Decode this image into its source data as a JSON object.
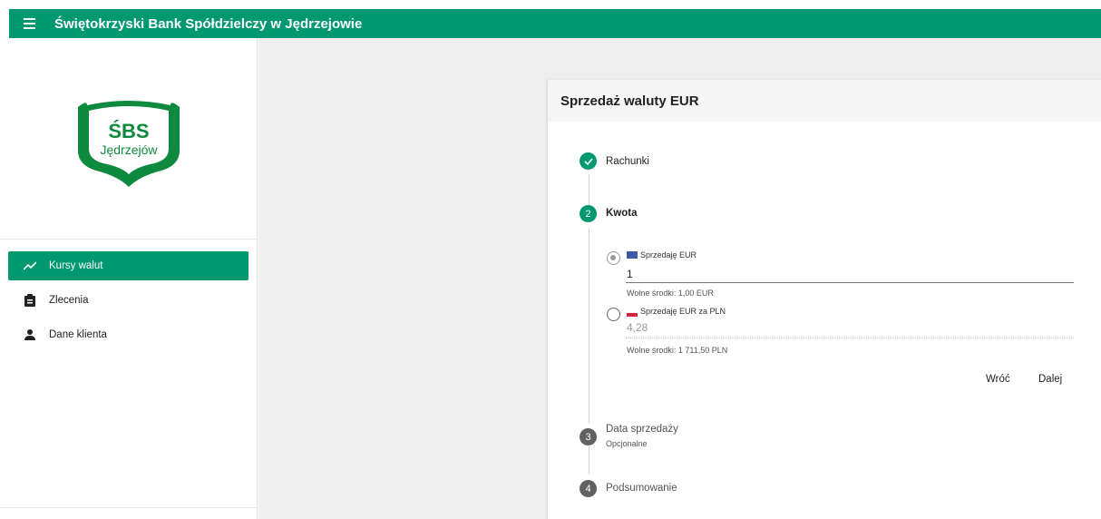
{
  "header": {
    "title": "Świętokrzyski Bank Spółdzielczy w Jędrzejowie"
  },
  "logo": {
    "line1": "ŚBS",
    "line2": "Jędrzejów"
  },
  "sidebar": {
    "items": [
      {
        "label": "Kursy walut",
        "icon": "trending-up-icon",
        "active": true
      },
      {
        "label": "Zlecenia",
        "icon": "clipboard-icon",
        "active": false
      },
      {
        "label": "Dane klienta",
        "icon": "person-icon",
        "active": false
      }
    ]
  },
  "card": {
    "title": "Sprzedaż waluty EUR",
    "steps": [
      {
        "number": "1",
        "label": "Rachunki",
        "state": "done"
      },
      {
        "number": "2",
        "label": "Kwota",
        "state": "active"
      },
      {
        "number": "3",
        "label": "Data sprzedaży",
        "sublabel": "Opcjonalne",
        "state": "pending"
      },
      {
        "number": "4",
        "label": "Podsumowanie",
        "state": "pending"
      }
    ],
    "amount": {
      "option1": {
        "label": "Sprzedaję EUR",
        "value": "1",
        "hint": "Wolne środki: 1,00 EUR",
        "selected": true
      },
      "option2": {
        "label": "Sprzedaję EUR za PLN",
        "value": "4,28",
        "hint": "Wolne środki: 1 711,50 PLN",
        "selected": false
      }
    },
    "buttons": {
      "back": "Wróć",
      "next": "Dalej"
    }
  },
  "colors": {
    "brand": "#009870",
    "step_pending": "#616161"
  }
}
